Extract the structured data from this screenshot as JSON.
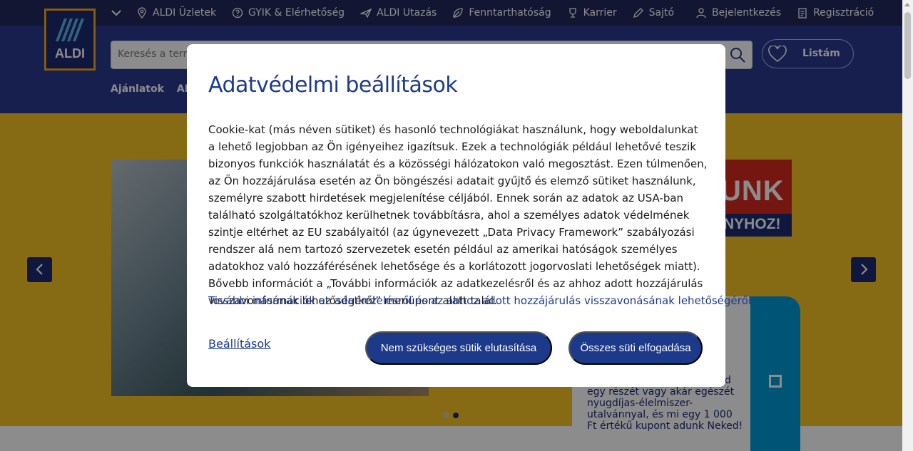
{
  "colors": {
    "topbar": "#21285e",
    "header": "#2b3990",
    "hero": "#f6c425",
    "modal_accent": "#1d3a8a",
    "promo_red": "#d52b1e",
    "card_blue": "#0099d6"
  },
  "topnav": {
    "items": [
      {
        "label": "ALDI Üzletek",
        "icon": "location-pin-icon"
      },
      {
        "label": "GYIK & Elérhetőség",
        "icon": "help-circle-icon"
      },
      {
        "label": "ALDI Utazás",
        "icon": "plane-icon"
      },
      {
        "label": "Fenntarthatóság",
        "icon": "leaf-icon"
      },
      {
        "label": "Karrier",
        "icon": "trophy-icon"
      },
      {
        "label": "Sajtó",
        "icon": "pencil-icon"
      }
    ],
    "login": {
      "label": "Bejelentkezés",
      "icon": "user-icon"
    },
    "register": {
      "label": "Regisztráció",
      "icon": "clipboard-icon"
    }
  },
  "logo": {
    "text": "ALDI"
  },
  "search": {
    "placeholder": "Keresés a termé"
  },
  "list_button": {
    "label": "Listám"
  },
  "mainnav": {
    "items": [
      "Ajánlatok",
      "ALD"
    ]
  },
  "hero": {
    "promo_line1": "UNK",
    "promo_line2": "NYHOZ!",
    "card_text": "egy részét vagy akár egészét nyugdíjas-élelmiszer-utalvánnyal, és mi egy 1 000 Ft értékű kupont adunk Neked!",
    "card_fragment": "d",
    "slide_count": 2,
    "active_slide": 2
  },
  "modal": {
    "title": "Adatvédelmi beállítások",
    "body": "Cookie-kat (más néven sütiket) és hasonló technológiákat használunk, hogy weboldalunkat a lehető legjobban az Ön igényeihez igazítsuk. Ezek a technológiák például lehetővé teszik bizonyos funkciók használatát és a közösségi hálózatokon való megosztást. Ezen túlmenően, az Ön hozzájárulása esetén az Ön böngészési adatait gyűjtő és elemző sütiket használunk, személyre szabott hirdetések megjelenítése céljából. Ennek során az adatok az USA-ban található szolgáltatókhoz kerülhetnek továbbításra, ahol a személyes adatok védelmének szintje eltérhet az EU szabályaitól (az úgynevezett „Data Privacy Framework” szabályozási rendszer alá nem tartozó szervezetek esetén például az amerikai hatóságok személyes adatokhoz való hozzáférésének lehetősége és a korlátozott jogorvoslati lehetőségek miatt). Bővebb információt a „További információk az adatkezelésről és az ahhoz adott hozzájárulás visszavonásának lehetőségéről” menüpont alatt talál.",
    "info_link": "További információk az adatkezelésről és az ahhoz adott hozzájárulás visszavonásának lehetőségéről",
    "settings_label": "Beállítások",
    "reject_label": "Nem szükséges sütik elutasítása",
    "accept_label": "Összes süti elfogadása"
  }
}
